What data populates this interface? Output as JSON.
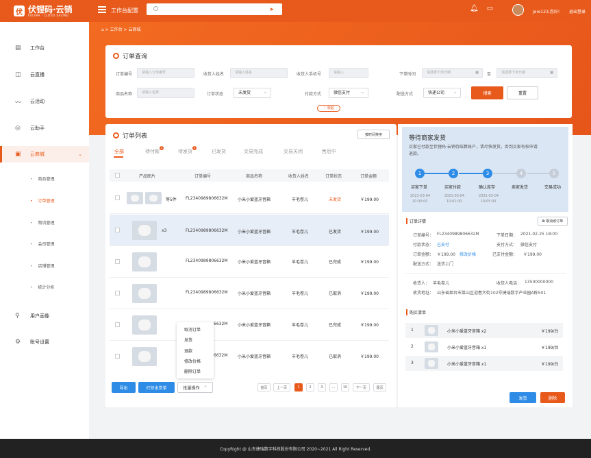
{
  "app": {
    "logo_mark": "伏",
    "title": "伏锂码·云销",
    "subtitle": "FULIMA · CLOUD SALING",
    "top_title": "工作台配置",
    "user": "Jere123,您好!",
    "logout": "退出登录"
  },
  "sidebar": {
    "items": [
      {
        "label": "工作台",
        "icon": "dashboard-icon",
        "glyph": "▤"
      },
      {
        "label": "云直播",
        "icon": "live-icon",
        "glyph": "◫"
      },
      {
        "label": "云活动",
        "icon": "activity-icon",
        "glyph": "〰"
      },
      {
        "label": "云助手",
        "icon": "assistant-icon",
        "glyph": "◎"
      },
      {
        "label": "云商城",
        "icon": "mall-icon",
        "glyph": "▣"
      },
      {
        "label": "用户画像",
        "icon": "user-icon",
        "glyph": "⚲"
      },
      {
        "label": "账号设置",
        "icon": "settings-icon",
        "glyph": "⚙"
      }
    ],
    "subitems": [
      "商品管理",
      "订单管理",
      "物流管理",
      "会员管理",
      "店铺管理",
      "统计分析"
    ]
  },
  "breadcrumb": "⌂ > 工作台 > 云商城",
  "query": {
    "title": "订单查询",
    "fields": {
      "order_no": {
        "label": "订单编号",
        "placeholder": "请输入订单编号"
      },
      "receiver": {
        "label": "收货人姓名",
        "placeholder": "请输入姓名"
      },
      "phone": {
        "label": "收货人手机号",
        "placeholder": "请输入"
      },
      "order_time": {
        "label": "下单时间",
        "placeholder_start": "请选择下单日期",
        "sep": "至",
        "placeholder_end": "请选择下单日期"
      },
      "product": {
        "label": "商品名称",
        "placeholder": "请输入名称"
      },
      "status": {
        "label": "订单状态",
        "value": "未发货"
      },
      "payment": {
        "label": "付款方式",
        "value": "微信支付"
      },
      "delivery": {
        "label": "配送方式",
        "value": "快递公司"
      }
    },
    "search_btn": "搜索",
    "reset_btn": "重置",
    "collapse": "⌃ 收起"
  },
  "orders": {
    "title": "订单列表",
    "sort_btn": "按时间排序",
    "tabs": [
      {
        "label": "全部"
      },
      {
        "label": "待付款",
        "badge": "1"
      },
      {
        "label": "待发货",
        "badge": "1"
      },
      {
        "label": "已发货"
      },
      {
        "label": "交易完成"
      },
      {
        "label": "交易关闭"
      },
      {
        "label": "售后中"
      }
    ],
    "headers": [
      "产品图片",
      "订单编号",
      "商品名称",
      "收货人姓名",
      "订单状态",
      "订单金额"
    ],
    "rows": [
      {
        "qty": "等5件",
        "order_no": "FL2340989806632M",
        "product": "小米小爱蓝牙音箱",
        "receiver": "羊毛卷儿",
        "status": "未发货",
        "amount": "￥199.00"
      },
      {
        "qty": "x3",
        "order_no": "FL2340989806632M",
        "product": "小米小爱蓝牙音箱",
        "receiver": "羊毛卷儿",
        "status": "已发货",
        "amount": "￥199.00"
      },
      {
        "qty": "",
        "order_no": "FL2340989806632M",
        "product": "小米小爱蓝牙音箱",
        "receiver": "羊毛卷儿",
        "status": "已完成",
        "amount": "￥199.00"
      },
      {
        "qty": "",
        "order_no": "FL2340989806632M",
        "product": "小米小爱蓝牙音箱",
        "receiver": "羊毛卷儿",
        "status": "已取消",
        "amount": "￥199.00"
      },
      {
        "qty": "",
        "order_no": "6632M",
        "product": "小米小爱蓝牙音箱",
        "receiver": "羊毛卷儿",
        "status": "已完成",
        "amount": "￥199.00"
      },
      {
        "qty": "",
        "order_no": "6632M",
        "product": "小米小爱蓝牙音箱",
        "receiver": "羊毛卷儿",
        "status": "已取消",
        "amount": "￥199.00"
      }
    ],
    "context_menu": [
      "取消订单",
      "发货",
      "退款",
      "修改价格",
      "删除订单"
    ],
    "export_btn": "导出",
    "print_btn": "打印出货单",
    "batch_btn": "批量操作",
    "pagination": [
      "首页",
      "上一页",
      "1",
      "2",
      "3",
      "...",
      "10",
      "下一页",
      "尾页"
    ]
  },
  "detail": {
    "status_title": "等待商家发货",
    "status_desc": "买家已付款至伏锂码·云销待结算账户，请尽快发货，否到买家有权申请退款。",
    "steps": [
      {
        "n": "1",
        "label": "买家下单",
        "date": "2021-03-04",
        "time": "10:00:00"
      },
      {
        "n": "2",
        "label": "买家付款",
        "date": "2021-03-04",
        "time": "10:01:00"
      },
      {
        "n": "3",
        "label": "确认库存",
        "date": "2021-03-04",
        "time": "10:05:00"
      },
      {
        "n": "4",
        "label": "卖家发货"
      },
      {
        "n": "5",
        "label": "交易成功"
      }
    ],
    "detail_title": "订单详情",
    "cancel_btn": "取消该订单",
    "order_no_label": "订单编号：",
    "order_no": "FL2340989806632M",
    "date_label": "下单日期：",
    "date": "2021-02-25 18:00",
    "pay_status_label": "付款状态：",
    "pay_status": "已支付",
    "pay_method_label": "支付方式：",
    "pay_method": "微信支付",
    "amount_label": "订单金额：",
    "amount": "￥199.00",
    "modify_price": "修改价格",
    "paid_label": "已支付金额：",
    "paid": "￥199.00",
    "delivery_label": "配送方式：",
    "delivery": "送货上门",
    "receiver_label": "收货人：",
    "receiver": "羊毛卷儿",
    "phone_label": "收货人电话：",
    "phone": "13500000000",
    "address_label": "收货地址：",
    "address": "山东省烟台市莱山区迎春大街102号捷瑞数字产业园A栋501",
    "purchase_title": "购买清单",
    "items": [
      {
        "n": "1",
        "name": "小米小爱蓝牙音箱 x2",
        "price": "￥199/台"
      },
      {
        "n": "2",
        "name": "小米小爱蓝牙音箱 x1",
        "price": "￥199/台"
      },
      {
        "n": "3",
        "name": "小米小爱蓝牙音箱 x1",
        "price": "￥199/台"
      }
    ],
    "ship_btn": "发货",
    "delete_btn": "删除"
  },
  "footer": "CopyRight @ 山东捷瑞数字科技股份有限公司 2020~2021 All Right Reserved."
}
